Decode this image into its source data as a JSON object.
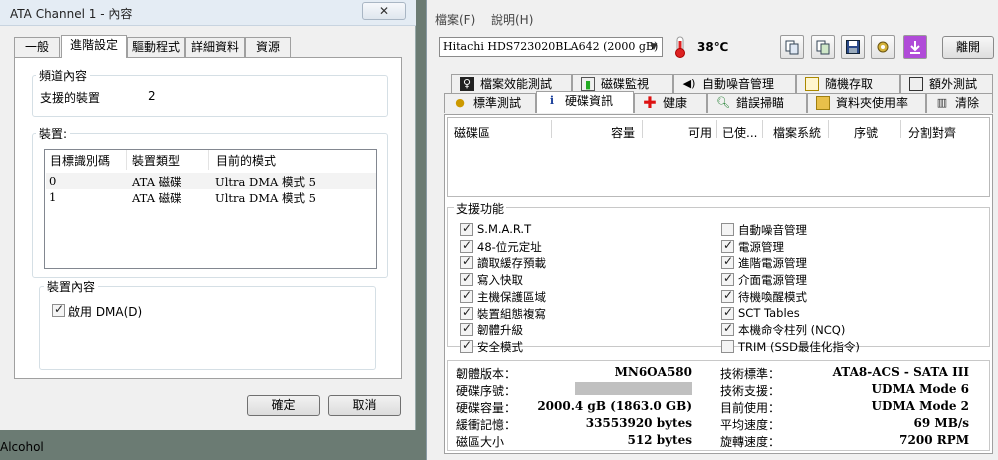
{
  "dialog": {
    "title": "ATA Channel 1 - 內容",
    "close_label": "✕",
    "tabs": [
      "一般",
      "進階設定",
      "驅動程式",
      "詳細資料",
      "資源"
    ],
    "channel": {
      "caption": "頻道內容",
      "supported_label": "支援的裝置",
      "supported_value": "2"
    },
    "devices": {
      "caption": "裝置:",
      "columns": [
        "目標識別碼",
        "裝置類型",
        "目前的模式"
      ],
      "rows": [
        [
          "0",
          "ATA 磁碟",
          "Ultra DMA 模式 5"
        ],
        [
          "1",
          "ATA 磁碟",
          "Ultra DMA 模式 5"
        ]
      ]
    },
    "device_props": {
      "caption": "裝置內容",
      "dma_label": "啟用 DMA(D)",
      "dma_checked": true
    },
    "ok_label": "確定",
    "cancel_label": "取消"
  },
  "app": {
    "menu": [
      "檔案(F)",
      "說明(H)"
    ],
    "drive": "Hitachi HDS723020BLA642  (2000 gB)",
    "temperature": "38℃",
    "toolbar_icons": [
      "copy-icon",
      "copy-info-icon",
      "save-icon",
      "options-icon",
      "download-icon"
    ],
    "exit_label": "離開",
    "tabs_row1": [
      {
        "label": "檔案效能測試",
        "icon": "file-benchmark-icon"
      },
      {
        "label": "磁碟監視",
        "icon": "disk-monitor-icon"
      },
      {
        "label": "自動噪音管理",
        "icon": "speaker-icon"
      },
      {
        "label": "隨機存取",
        "icon": "random-access-icon"
      },
      {
        "label": "額外測試",
        "icon": "extra-tests-icon"
      }
    ],
    "tabs_row2": [
      {
        "label": "標準測試",
        "icon": "benchmark-icon"
      },
      {
        "label": "硬碟資訊",
        "icon": "info-icon"
      },
      {
        "label": "健康",
        "icon": "health-cross-icon"
      },
      {
        "label": "錯誤掃瞄",
        "icon": "magnifier-icon"
      },
      {
        "label": "資料夾使用率",
        "icon": "folder-icon"
      },
      {
        "label": "清除",
        "icon": "trash-icon"
      }
    ],
    "partition_columns": [
      "磁碟區",
      "容量",
      "可用",
      "已使...",
      "檔案系統",
      "序號",
      "分割對齊"
    ],
    "features_caption": "支援功能",
    "features_left": [
      {
        "label": "S.M.A.R.T",
        "checked": true
      },
      {
        "label": "48-位元定址",
        "checked": true
      },
      {
        "label": "讀取緩存預載",
        "checked": true
      },
      {
        "label": "寫入快取",
        "checked": true
      },
      {
        "label": "主機保護區域",
        "checked": true
      },
      {
        "label": "裝置組態複寫",
        "checked": true
      },
      {
        "label": "韌體升級",
        "checked": true
      },
      {
        "label": "安全模式",
        "checked": true
      }
    ],
    "features_right": [
      {
        "label": "自動噪音管理",
        "checked": false
      },
      {
        "label": "電源管理",
        "checked": true
      },
      {
        "label": "進階電源管理",
        "checked": true
      },
      {
        "label": "介面電源管理",
        "checked": true
      },
      {
        "label": "待機喚醒模式",
        "checked": true
      },
      {
        "label": "SCT Tables",
        "checked": true
      },
      {
        "label": "本機命令柱列 (NCQ)",
        "checked": true
      },
      {
        "label": "TRIM (SSD最佳化指令)",
        "checked": false
      }
    ],
    "info_left": [
      {
        "label": "韌體版本：",
        "value": "MN6OA580"
      },
      {
        "label": "硬碟序號：",
        "value": ""
      },
      {
        "label": "硬碟容量：",
        "value": "2000.4 gB (1863.0 GB)"
      },
      {
        "label": "緩衝記憶：",
        "value": "33553920 bytes"
      },
      {
        "label": "磁區大小",
        "value": "512 bytes"
      }
    ],
    "info_right": [
      {
        "label": "技術標準：",
        "value": "ATA8-ACS - SATA III"
      },
      {
        "label": "技術支援：",
        "value": "UDMA Mode 6"
      },
      {
        "label": "目前使用：",
        "value": "UDMA Mode 2"
      },
      {
        "label": "平均速度：",
        "value": "69 MB/s"
      },
      {
        "label": "旋轉速度：",
        "value": "7200 RPM"
      }
    ]
  },
  "desktop": {
    "icon_label": "Alcohol"
  }
}
